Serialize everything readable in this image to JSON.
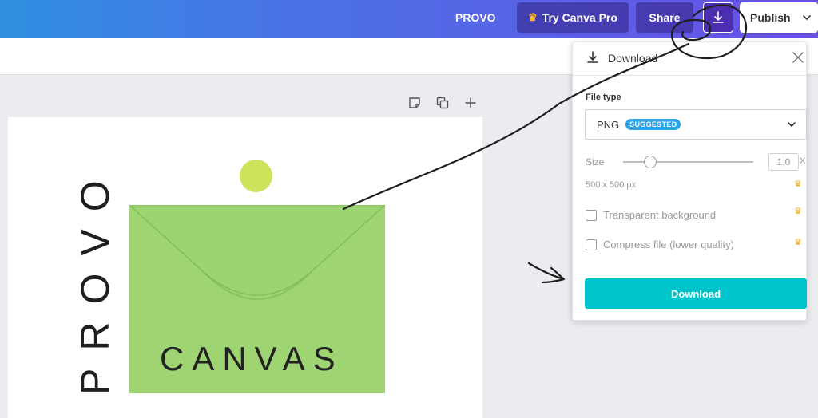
{
  "topbar": {
    "project_title": "PROVO",
    "try_pro_label": "Try Canva Pro",
    "share_label": "Share",
    "download_icon": "download-icon",
    "publish_label": "Publish"
  },
  "page_tools": {
    "icons": [
      "sticky-note-icon",
      "duplicate-icon",
      "plus-icon"
    ]
  },
  "design": {
    "vertical_text": "PROVO",
    "envelope_text": "CANVAS",
    "colors": {
      "dot": "#cde35a",
      "envelope": "#a3d977"
    }
  },
  "download_panel": {
    "title": "Download",
    "file_type_label": "File type",
    "file_type_value": "PNG",
    "suggested_badge": "SUGGESTED",
    "size_label": "Size",
    "size_value": "1,0",
    "size_suffix": "X",
    "dimensions": "500 x 500 px",
    "options": [
      {
        "label": "Transparent background",
        "checked": false,
        "pro": true
      },
      {
        "label": "Compress file (lower quality)",
        "checked": false,
        "pro": true
      }
    ],
    "download_button": "Download",
    "accent_color": "#00c4cc"
  }
}
